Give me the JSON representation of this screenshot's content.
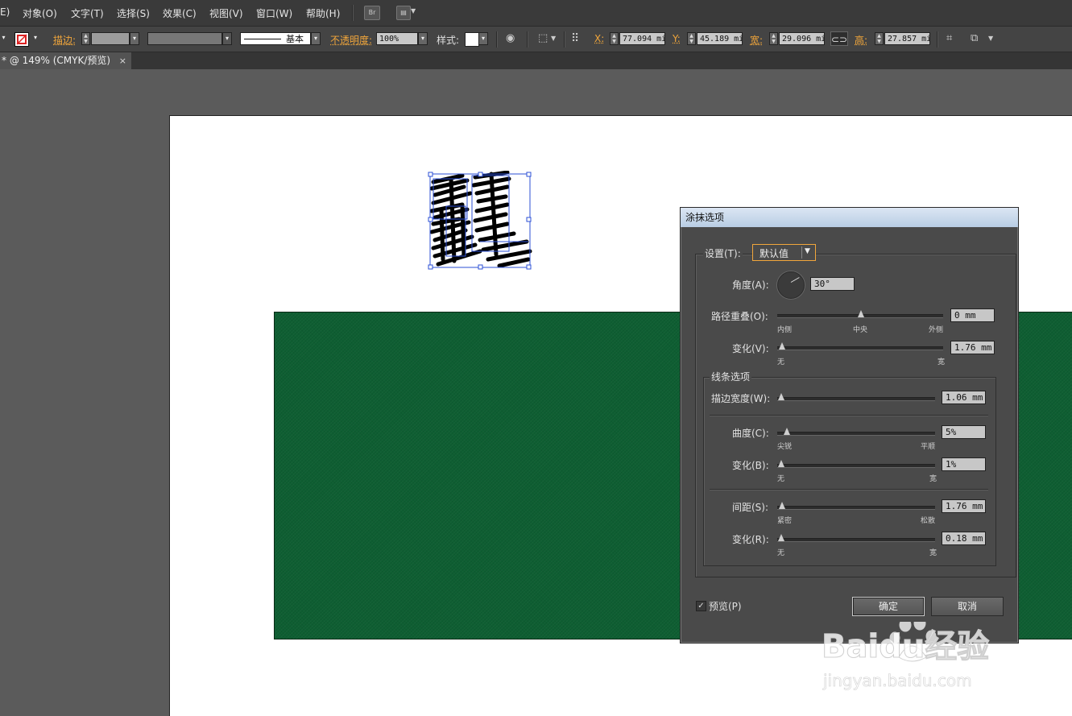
{
  "menubar": {
    "items": [
      "E)",
      "对象(O)",
      "文字(T)",
      "选择(S)",
      "效果(C)",
      "视图(V)",
      "窗口(W)",
      "帮助(H)"
    ],
    "bridge_icon_label": "Br"
  },
  "controlbar": {
    "stroke_label": "描边:",
    "stroke_style": "基本",
    "opacity_label": "不透明度:",
    "opacity_value": "100%",
    "style_label": "样式:",
    "x_label": "X:",
    "x_value": "77.094 mi",
    "y_label": "Y:",
    "y_value": "45.189 mi",
    "w_label": "宽:",
    "w_value": "29.096 mi",
    "h_label": "高:",
    "h_value": "27.857 mi"
  },
  "tab": {
    "title": "* @ 149% (CMYK/预览)",
    "close": "×"
  },
  "dialog": {
    "title": "涂抹选项",
    "settings_label": "设置(T):",
    "settings_value": "默认值",
    "angle_label": "角度(A):",
    "angle_value": "30°",
    "path_overlap_label": "路径重叠(O):",
    "path_overlap_value": "0 mm",
    "path_overlap_min": "内侧",
    "path_overlap_mid": "中央",
    "path_overlap_max": "外侧",
    "variation1_label": "变化(V):",
    "variation1_value": "1.76 mm",
    "variation1_min": "无",
    "variation1_max": "宽",
    "line_options_label": "线条选项",
    "stroke_width_label": "描边宽度(W):",
    "stroke_width_value": "1.06 mm",
    "curviness_label": "曲度(C):",
    "curviness_value": "5%",
    "curviness_min": "尖锐",
    "curviness_max": "平顺",
    "variation2_label": "变化(B):",
    "variation2_value": "1%",
    "variation2_min": "无",
    "variation2_max": "宽",
    "spacing_label": "间距(S):",
    "spacing_value": "1.76 mm",
    "spacing_min": "紧密",
    "spacing_max": "松散",
    "variation3_label": "变化(R):",
    "variation3_value": "0.18 mm",
    "variation3_min": "无",
    "variation3_max": "宽",
    "preview_label": "预览(P)",
    "ok_label": "确定",
    "cancel_label": "取消"
  },
  "watermark": {
    "brand": "Baidu经验",
    "url": "jingyan.baidu.com"
  },
  "colors": {
    "accent_orange": "#f1a63b",
    "green_rect": "#0e5e32"
  }
}
